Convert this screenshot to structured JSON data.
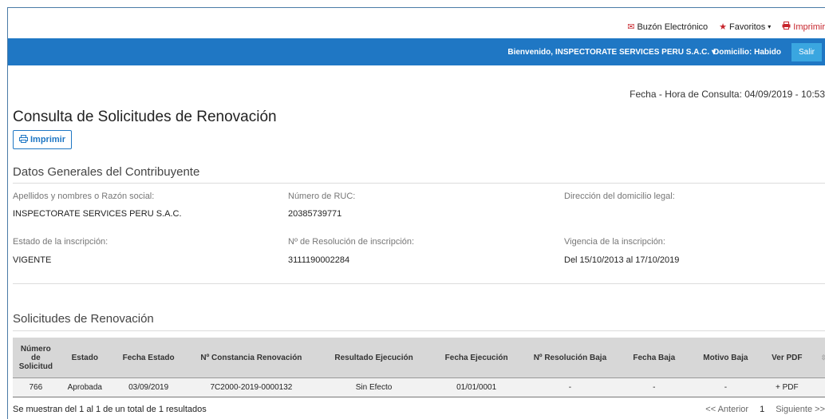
{
  "topbar": {
    "buzon": "Buzón Electrónico",
    "favoritos": "Favoritos",
    "imprimir": "Imprimir"
  },
  "bluebar": {
    "welcome": "Bienvenido, INSPECTORATE SERVICES PERU S.A.C.",
    "domicilio": "Domicilio: Habido",
    "salir": "Salir"
  },
  "fecha": "Fecha - Hora de Consulta: 04/09/2019 - 10:53",
  "title": "Consulta de Solicitudes de Renovación",
  "print_button": "Imprimir",
  "datos": {
    "title": "Datos Generales del Contribuyente",
    "razon_label": "Apellidos y nombres o Razón social:",
    "razon_value": "INSPECTORATE SERVICES PERU S.A.C.",
    "ruc_label": "Número de RUC:",
    "ruc_value": "20385739771",
    "direccion_label": "Dirección del domicilio legal:",
    "estado_label": "Estado de la inscripción:",
    "estado_value": "VIGENTE",
    "resolucion_label": "Nº de Resolución de inscripción:",
    "resolucion_value": "3111190002284",
    "vigencia_label": "Vigencia de la inscripción:",
    "vigencia_value": "Del 15/10/2013 al 17/10/2019"
  },
  "solicitudes": {
    "title": "Solicitudes de Renovación",
    "headers": [
      "Número de Solicitud",
      "Estado",
      "Fecha Estado",
      "Nº Constancia Renovación",
      "Resultado Ejecución",
      "Fecha Ejecución",
      "Nº Resolución Baja",
      "Fecha Baja",
      "Motivo Baja",
      "Ver PDF"
    ],
    "rows": [
      [
        "766",
        "Aprobada",
        "03/09/2019",
        "7C2000-2019-0000132",
        "Sin Efecto",
        "01/01/0001",
        "-",
        "-",
        "-",
        "+ PDF"
      ]
    ]
  },
  "footer": {
    "info": "Se muestran del 1 al 1 de un total de 1 resultados",
    "prev": "<< Anterior",
    "page": "1",
    "next": "Siguiente >>"
  },
  "colors": {
    "primary": "#1f77c4",
    "accent_red": "#c7252c",
    "salir_bg": "#3aa6e0"
  }
}
